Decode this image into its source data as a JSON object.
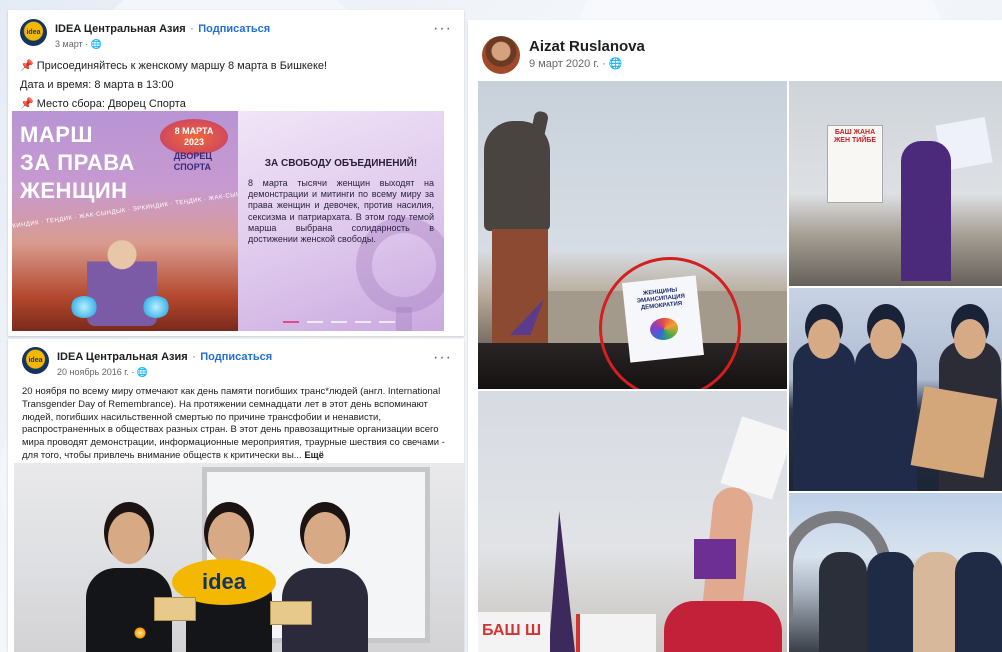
{
  "post1": {
    "page_name": "IDEA Центральная Азия",
    "separator": "·",
    "follow_label": "Подписаться",
    "date": "3 март · ",
    "more_label": "···",
    "line1": "📌 Присоединяйтесь к женскому маршу 8 марта в Бишкеке!",
    "line2": "Дата и время: 8 марта в 13:00",
    "line3": "📌 Место сбора: Дворец Спорта",
    "poster_left": {
      "title": "МАРШ\nЗА ПРАВА\nЖЕНЩИН",
      "date": "8 МАРТА\n2023",
      "venue": "ДВОРЕЦ\nСПОРТА",
      "band": "ЭРКИНДИК · ТЕҢДИК · ЖАК-СЫНДЫК · ЭРКИНДИК · ТЕҢДИК · ЖАК-СЫНДЫК"
    },
    "poster_right": {
      "heading": "ЗА СВОБОДУ ОБЪЕДИНЕНИЙ!",
      "body": "8 марта тысячи женщин выходят на демонстрации и митинги по всему миру за права женщин и девочек, против насилия, сексизма и патриархата. В этом году темой марша выбрана солидарность в достижении женской свободы."
    }
  },
  "post2": {
    "page_name": "IDEA Центральная Азия",
    "separator": "·",
    "follow_label": "Подписаться",
    "date": "20 ноябрь 2016 г. · ",
    "more_label": "···",
    "text": "20 ноября по всему миру отмечают как день памяти погибших транс*людей (англ. International Transgender Day of Remembrance). На протяжении семнадцати лет в этот день вспоминают людей, погибших насильственной смертью по причине трансфобии и ненависти, распространенных в обществах разных стран. В этот день правозащитные организации всего мира проводят демонстрации, информационные мероприятия, траурные шествия со свечами - для того, чтобы привлечь внимание обществ к критически вы... ",
    "see_more": "Ещё",
    "sign_text": "idea"
  },
  "post3": {
    "author_name": "Aizat Ruslanova",
    "date": "9 март 2020 г. · ",
    "sign_text": "ЖЕНЩИНЫ ЭМАНСИПАЦИЯ ДЕМОКРАТИЯ",
    "sign_a_text": "БАШ ЖАНА ЖЕН ТИЙБЕ",
    "banner_text": "БАШ Ш"
  },
  "colors": {
    "link": "#216fdb",
    "highlight": "#d21f1f",
    "idea_yellow": "#f5b800",
    "idea_navy": "#13345f"
  },
  "icons": {
    "pin": "pushpin-icon",
    "globe": "globe-icon",
    "more": "ellipsis-icon"
  }
}
